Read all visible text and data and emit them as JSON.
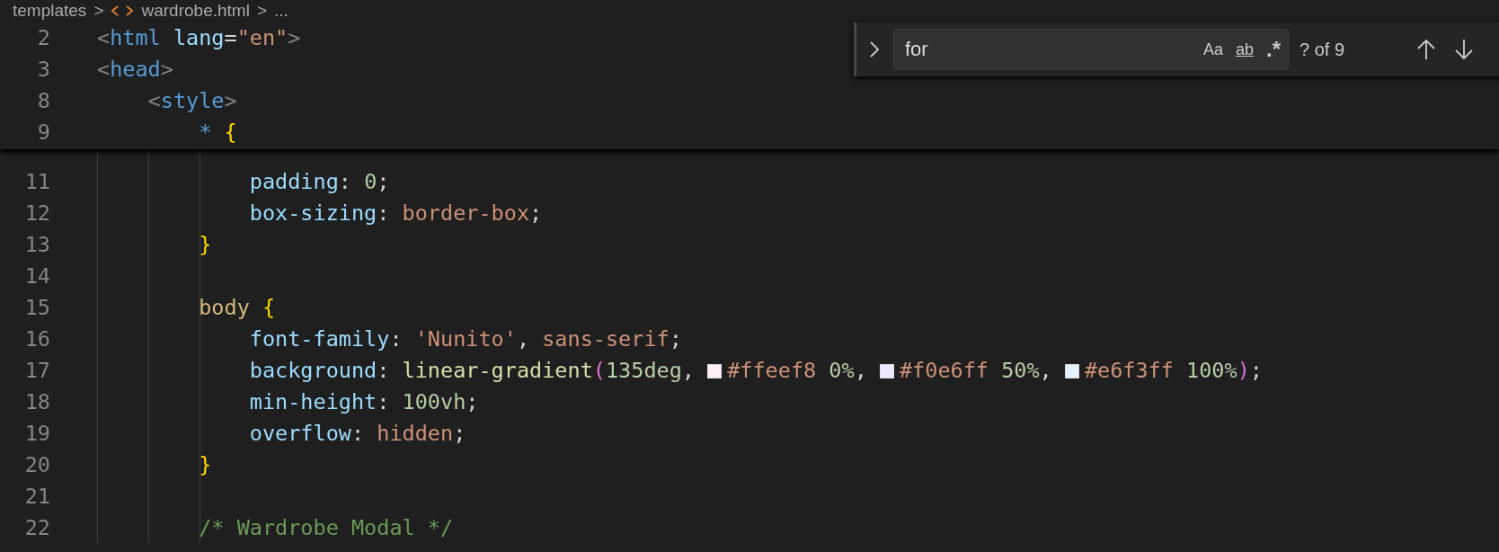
{
  "breadcrumb": [
    {
      "kind": "folder",
      "text": "templates"
    },
    {
      "kind": "sep",
      "text": ">"
    },
    {
      "kind": "file",
      "text": "wardrobe.html"
    },
    {
      "kind": "sep",
      "text": ">"
    },
    {
      "kind": "more",
      "text": "..."
    }
  ],
  "sticky_lines": [
    {
      "number": "2",
      "tokens": [
        {
          "kind": "punct",
          "text": "<"
        },
        {
          "kind": "tag",
          "text": "html"
        },
        {
          "kind": "attr",
          "text": " lang"
        },
        {
          "kind": "plain",
          "text": "="
        },
        {
          "kind": "string",
          "text": "\"en\""
        },
        {
          "kind": "punct",
          "text": ">"
        }
      ]
    },
    {
      "number": "3",
      "tokens": [
        {
          "kind": "punct",
          "text": "<"
        },
        {
          "kind": "tag",
          "text": "head"
        },
        {
          "kind": "punct",
          "text": ">"
        }
      ]
    },
    {
      "number": "8",
      "tokens": [
        {
          "kind": "punct",
          "text": "    <"
        },
        {
          "kind": "tag",
          "text": "style"
        },
        {
          "kind": "punct",
          "text": ">"
        }
      ]
    },
    {
      "number": "9",
      "tokens": [
        {
          "kind": "tag",
          "text": "        *"
        },
        {
          "kind": "brace",
          "text": " {"
        }
      ]
    }
  ],
  "lines": [
    {
      "number": "11",
      "tokens": [
        {
          "kind": "prop",
          "text": "            padding"
        },
        {
          "kind": "plain",
          "text": ": "
        },
        {
          "kind": "number",
          "text": "0"
        },
        {
          "kind": "plain",
          "text": ";"
        }
      ]
    },
    {
      "number": "12",
      "tokens": [
        {
          "kind": "prop",
          "text": "            box-sizing"
        },
        {
          "kind": "plain",
          "text": ": "
        },
        {
          "kind": "value",
          "text": "border-box"
        },
        {
          "kind": "plain",
          "text": ";"
        }
      ]
    },
    {
      "number": "13",
      "tokens": [
        {
          "kind": "brace",
          "text": "        }"
        }
      ]
    },
    {
      "number": "14"
    },
    {
      "number": "15",
      "tokens": [
        {
          "kind": "selector",
          "text": "        body"
        },
        {
          "kind": "brace",
          "text": " {"
        }
      ]
    },
    {
      "number": "16",
      "tokens": [
        {
          "kind": "prop",
          "text": "            font-family"
        },
        {
          "kind": "plain",
          "text": ": "
        },
        {
          "kind": "value",
          "text": "'Nunito'"
        },
        {
          "kind": "plain",
          "text": ", "
        },
        {
          "kind": "value",
          "text": "sans-serif"
        },
        {
          "kind": "plain",
          "text": ";"
        }
      ]
    },
    {
      "number": "17",
      "tokens": [
        {
          "kind": "prop",
          "text": "            background"
        },
        {
          "kind": "plain",
          "text": ": "
        },
        {
          "kind": "func",
          "text": "linear-gradient"
        },
        {
          "kind": "paren",
          "text": "("
        },
        {
          "kind": "number",
          "text": "135deg"
        },
        {
          "kind": "plain",
          "text": ", "
        },
        {
          "kind": "swatch",
          "color": "#ffeef8"
        },
        {
          "kind": "value",
          "text": "#ffeef8"
        },
        {
          "kind": "number",
          "text": " 0%"
        },
        {
          "kind": "plain",
          "text": ", "
        },
        {
          "kind": "swatch",
          "color": "#f0e6ff"
        },
        {
          "kind": "value",
          "text": "#f0e6ff"
        },
        {
          "kind": "number",
          "text": " 50%"
        },
        {
          "kind": "plain",
          "text": ", "
        },
        {
          "kind": "swatch",
          "color": "#e6f3ff"
        },
        {
          "kind": "value",
          "text": "#e6f3ff"
        },
        {
          "kind": "number",
          "text": " 100%"
        },
        {
          "kind": "paren",
          "text": ")"
        },
        {
          "kind": "plain",
          "text": ";"
        }
      ]
    },
    {
      "number": "18",
      "tokens": [
        {
          "kind": "prop",
          "text": "            min-height"
        },
        {
          "kind": "plain",
          "text": ": "
        },
        {
          "kind": "number",
          "text": "100vh"
        },
        {
          "kind": "plain",
          "text": ";"
        }
      ]
    },
    {
      "number": "19",
      "tokens": [
        {
          "kind": "prop",
          "text": "            overflow"
        },
        {
          "kind": "plain",
          "text": ": "
        },
        {
          "kind": "value",
          "text": "hidden"
        },
        {
          "kind": "plain",
          "text": ";"
        }
      ]
    },
    {
      "number": "20",
      "tokens": [
        {
          "kind": "brace",
          "text": "        }"
        }
      ]
    },
    {
      "number": "21"
    },
    {
      "number": "22",
      "tokens": [
        {
          "kind": "comment",
          "text": "        /* Wardrobe Modal */"
        }
      ]
    }
  ],
  "find": {
    "value": "for",
    "options": [
      {
        "kind": "case",
        "text": "Aa"
      },
      {
        "kind": "word",
        "text": "ab"
      },
      {
        "kind": "regex",
        "text": ".*"
      }
    ],
    "count": "? of 9"
  }
}
